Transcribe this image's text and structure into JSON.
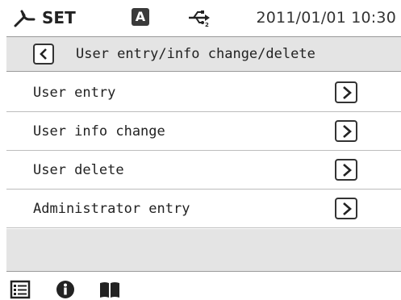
{
  "status_bar": {
    "mode_label": "SET",
    "badge_letter": "A",
    "datetime": "2011/01/01 10:30",
    "icons": [
      "wrench-icon",
      "usb-icon"
    ]
  },
  "title_bar": {
    "back_icon": "chevron-left-icon",
    "title": "User entry/info change/delete"
  },
  "menu": {
    "items": [
      {
        "label": "User entry",
        "icon": "chevron-right-icon"
      },
      {
        "label": "User info change",
        "icon": "chevron-right-icon"
      },
      {
        "label": "User delete",
        "icon": "chevron-right-icon"
      },
      {
        "label": "Administrator entry",
        "icon": "chevron-right-icon"
      }
    ]
  },
  "toolbar": {
    "icons": [
      "list-icon",
      "info-icon",
      "book-icon"
    ]
  },
  "colors": {
    "band_gray": "#e4e4e4",
    "text": "#222222",
    "divider": "#bdbdbd"
  }
}
